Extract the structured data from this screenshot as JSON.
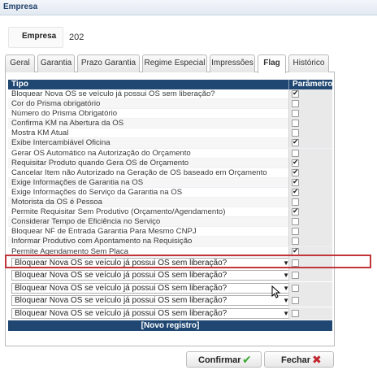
{
  "window": {
    "title": "Empresa"
  },
  "company": {
    "label": "Empresa",
    "value": "202"
  },
  "tabs": [
    {
      "label": "Geral",
      "active": false
    },
    {
      "label": "Garantia",
      "active": false
    },
    {
      "label": "Prazo Garantia",
      "active": false
    },
    {
      "label": "Regime Especial",
      "active": false
    },
    {
      "label": "Impressões",
      "active": false
    },
    {
      "label": "Flag",
      "active": true
    },
    {
      "label": "Histórico",
      "active": false
    }
  ],
  "grid": {
    "columns": {
      "tipo": "Tipo",
      "parametro": "Parâmetro"
    },
    "rows": [
      {
        "label": "Bloquear Nova OS se veículo já possui OS sem liberação?",
        "checked": true
      },
      {
        "label": "Cor do Prisma obrigatório",
        "checked": false
      },
      {
        "label": "Número do Prisma Obrigatório",
        "checked": false
      },
      {
        "label": "Confirma KM na Abertura da OS",
        "checked": false
      },
      {
        "label": "Mostra KM Atual",
        "checked": false
      },
      {
        "label": "Exibe Intercambiável Oficina",
        "checked": true
      },
      {
        "label": "Gerar OS Automático na Autorização do Orçamento",
        "checked": false
      },
      {
        "label": "Requisitar Produto quando Gera OS de Orçamento",
        "checked": true
      },
      {
        "label": "Cancelar Item não Autorizado na Geração de OS baseado em Orçamento",
        "checked": true
      },
      {
        "label": "Exige Informações de Garantia na OS",
        "checked": true
      },
      {
        "label": "Exige Informações do Serviço da Garantia na OS",
        "checked": true
      },
      {
        "label": "Motorista da OS é Pessoa",
        "checked": false
      },
      {
        "label": "Permite Requisitar Sem Produtivo (Orçamento/Agendamento)",
        "checked": true
      },
      {
        "label": "Considerar Tempo de Eficiência no Serviço",
        "checked": false
      },
      {
        "label": "Bloquear NF de Entrada Garantia Para Mesmo CNPJ",
        "checked": false
      },
      {
        "label": "Informar Produtivo com Apontamento na Requisição",
        "checked": false
      },
      {
        "label": "Permite Agendamento Sem Placa",
        "checked": true
      }
    ],
    "new_rows": [
      {
        "value": "Bloquear Nova OS se veículo já possui OS sem liberação?",
        "checked": false
      },
      {
        "value": "Bloquear Nova OS se veículo já possui OS sem liberação?",
        "checked": false
      },
      {
        "value": "Bloquear Nova OS se veículo já possui OS sem liberação?",
        "checked": false
      },
      {
        "value": "Bloquear Nova OS se veículo já possui OS sem liberação?",
        "checked": false
      },
      {
        "value": "Bloquear Nova OS se veículo já possui OS sem liberação?",
        "checked": false
      }
    ],
    "new_record_label": "[Novo registro]"
  },
  "buttons": {
    "confirm": {
      "label": "Confirmar",
      "icon": "check-icon",
      "color": "#3aa832"
    },
    "close": {
      "label": "Fechar",
      "icon": "x-icon",
      "color": "#c0262d"
    }
  },
  "highlight_color": "#c0343a",
  "header_color": "#1f4771"
}
